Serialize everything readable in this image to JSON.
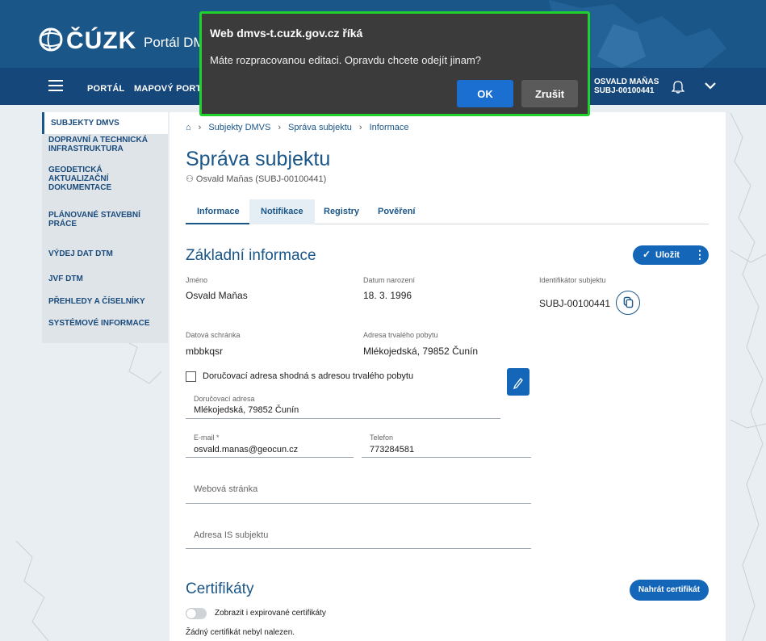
{
  "header": {
    "logo_text": "ČÚZK",
    "portal_title": "Portál DM",
    "nav": [
      "PORTÁL",
      "MAPOVÝ PORT"
    ],
    "user_name": "OSVALD MAŇAS",
    "user_id": "SUBJ-00100441"
  },
  "sidebar": {
    "items": [
      {
        "label": "SUBJEKTY DMVS"
      },
      {
        "label": "DOPRAVNÍ A TECHNICKÁ INFRASTRUKTURA"
      },
      {
        "label": "GEODETICKÁ AKTUALIZAČNÍ DOKUMENTACE"
      },
      {
        "label": "PLÁNOVANÉ STAVEBNÍ PRÁCE"
      },
      {
        "label": "VÝDEJ DAT DTM"
      },
      {
        "label": "JVF DTM"
      },
      {
        "label": "PŘEHLEDY A ČÍSELNÍKY"
      },
      {
        "label": "SYSTÉMOVÉ INFORMACE"
      }
    ]
  },
  "breadcrumb": [
    "Subjekty DMVS",
    "Správa subjektu",
    "Informace"
  ],
  "page": {
    "title": "Správa subjektu",
    "subtitle": "Osvald Maňas (SUBJ-00100441)",
    "tabs": [
      "Informace",
      "Notifikace",
      "Registry",
      "Pověření"
    ]
  },
  "basic": {
    "heading": "Základní informace",
    "save_label": "Uložit",
    "name_label": "Jméno",
    "name_value": "Osvald Maňas",
    "dob_label": "Datum narození",
    "dob_value": "18. 3. 1996",
    "id_label": "Identifikátor subjektu",
    "id_value": "SUBJ-00100441",
    "box_label": "Datová schránka",
    "box_value": "mbbkqsr",
    "addr_label": "Adresa trvalého pobytu",
    "addr_value": "Mlékojedská, 79852 Čunín",
    "same_addr_label": "Doručovací adresa shodná s adresou trvalého pobytu",
    "delivery_label": "Doručovací adresa",
    "delivery_value": "Mlékojedská, 79852 Čunín",
    "email_label": "E-mail *",
    "email_value": "osvald.manas@geocun.cz",
    "phone_label": "Telefon",
    "phone_value": "773284581",
    "web_placeholder": "Webová stránka",
    "is_placeholder": "Adresa IS subjektu"
  },
  "certs": {
    "heading": "Certifikáty",
    "upload_label": "Nahrát certifikát",
    "toggle_label": "Zobrazit i expirované certifikáty",
    "empty_text": "Žádný certifikát nebyl nalezen."
  },
  "dialog": {
    "title": "Web dmvs-t.cuzk.gov.cz říká",
    "message": "Máte rozpracovanou editaci. Opravdu chcete odejít jinam?",
    "ok_label": "OK",
    "cancel_label": "Zrušit",
    "border_color": "#1fd12a"
  },
  "colors": {
    "header": "#1a5688",
    "accent": "#1466b8"
  }
}
